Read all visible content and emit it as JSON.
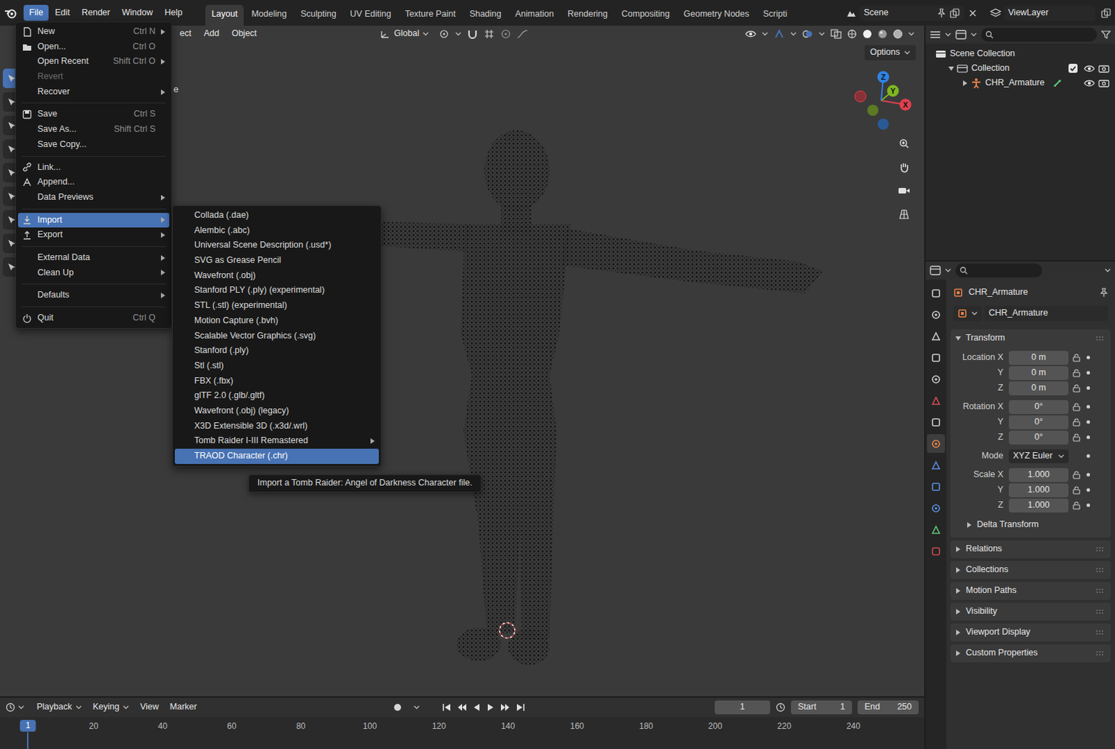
{
  "topbar": {
    "menus": [
      {
        "label": "File",
        "selected": true
      },
      {
        "label": "Edit",
        "selected": false
      },
      {
        "label": "Render",
        "selected": false
      },
      {
        "label": "Window",
        "selected": false
      },
      {
        "label": "Help",
        "selected": false
      }
    ],
    "workspaces": [
      {
        "label": "Layout",
        "selected": true
      },
      {
        "label": "Modeling",
        "selected": false
      },
      {
        "label": "Sculpting",
        "selected": false
      },
      {
        "label": "UV Editing",
        "selected": false
      },
      {
        "label": "Texture Paint",
        "selected": false
      },
      {
        "label": "Shading",
        "selected": false
      },
      {
        "label": "Animation",
        "selected": false
      },
      {
        "label": "Rendering",
        "selected": false
      },
      {
        "label": "Compositing",
        "selected": false
      },
      {
        "label": "Geometry Nodes",
        "selected": false
      },
      {
        "label": "Scripti",
        "selected": false
      }
    ],
    "scene": "Scene",
    "view_layer": "ViewLayer"
  },
  "viewport": {
    "corner_text": "e",
    "header": [
      "ect",
      "Add",
      "Object"
    ],
    "orientation": "Global",
    "options": "Options",
    "gizmo": [
      "X",
      "Y",
      "Z"
    ]
  },
  "file_menu": {
    "sections": [
      [
        {
          "label": "New",
          "shortcut": "Ctrl N",
          "submenu": true,
          "disabled": false,
          "selected": false
        },
        {
          "label": "Open...",
          "shortcut": "Ctrl O",
          "submenu": false,
          "disabled": false,
          "selected": false
        },
        {
          "label": "Open Recent",
          "shortcut": "Shift Ctrl O",
          "submenu": true,
          "disabled": false,
          "selected": false
        },
        {
          "label": "Revert",
          "submenu": false,
          "disabled": true,
          "selected": false
        },
        {
          "label": "Recover",
          "submenu": true,
          "disabled": false,
          "selected": false
        }
      ],
      [
        {
          "label": "Save",
          "shortcut": "Ctrl S",
          "submenu": false,
          "disabled": false,
          "selected": false
        },
        {
          "label": "Save As...",
          "shortcut": "Shift Ctrl S",
          "submenu": false,
          "disabled": false,
          "selected": false
        },
        {
          "label": "Save Copy...",
          "submenu": false,
          "disabled": false,
          "selected": false
        }
      ],
      [
        {
          "label": "Link...",
          "submenu": false,
          "disabled": false,
          "selected": false
        },
        {
          "label": "Append...",
          "submenu": false,
          "disabled": false,
          "selected": false
        },
        {
          "label": "Data Previews",
          "submenu": true,
          "disabled": false,
          "selected": false
        }
      ],
      [
        {
          "label": "Import",
          "submenu": true,
          "disabled": false,
          "selected": true
        },
        {
          "label": "Export",
          "submenu": true,
          "disabled": false,
          "selected": false
        }
      ],
      [
        {
          "label": "External Data",
          "submenu": true,
          "disabled": false,
          "selected": false
        },
        {
          "label": "Clean Up",
          "submenu": true,
          "disabled": false,
          "selected": false
        }
      ],
      [
        {
          "label": "Defaults",
          "submenu": true,
          "disabled": false,
          "selected": false
        }
      ],
      [
        {
          "label": "Quit",
          "shortcut": "Ctrl Q",
          "submenu": false,
          "disabled": false,
          "selected": false
        }
      ]
    ]
  },
  "import_menu": {
    "items": [
      {
        "label": "Collada (.dae)",
        "submenu": false,
        "selected": false
      },
      {
        "label": "Alembic (.abc)",
        "submenu": false,
        "selected": false
      },
      {
        "label": "Universal Scene Description (.usd*)",
        "submenu": false,
        "selected": false
      },
      {
        "label": "SVG as Grease Pencil",
        "submenu": false,
        "selected": false
      },
      {
        "label": "Wavefront (.obj)",
        "submenu": false,
        "selected": false
      },
      {
        "label": "Stanford PLY (.ply) (experimental)",
        "submenu": false,
        "selected": false
      },
      {
        "label": "STL (.stl) (experimental)",
        "submenu": false,
        "selected": false
      },
      {
        "label": "Motion Capture (.bvh)",
        "submenu": false,
        "selected": false
      },
      {
        "label": "Scalable Vector Graphics (.svg)",
        "submenu": false,
        "selected": false
      },
      {
        "label": "Stanford (.ply)",
        "submenu": false,
        "selected": false
      },
      {
        "label": "Stl (.stl)",
        "submenu": false,
        "selected": false
      },
      {
        "label": "FBX (.fbx)",
        "submenu": false,
        "selected": false
      },
      {
        "label": "glTF 2.0 (.glb/.gltf)",
        "submenu": false,
        "selected": false
      },
      {
        "label": "Wavefront (.obj) (legacy)",
        "submenu": false,
        "selected": false
      },
      {
        "label": "X3D Extensible 3D (.x3d/.wrl)",
        "submenu": false,
        "selected": false
      },
      {
        "label": "Tomb Raider I-III Remastered",
        "submenu": true,
        "selected": false
      },
      {
        "label": "TRAOD Character (.chr)",
        "submenu": false,
        "selected": true
      }
    ]
  },
  "tooltip": "Import a Tomb Raider: Angel of Darkness Character file.",
  "outliner": {
    "rows": [
      {
        "label": "Scene Collection",
        "level": 0,
        "kind": "root"
      },
      {
        "label": "Collection",
        "level": 1,
        "kind": "collection",
        "expanded": true,
        "checked": true,
        "visible": true,
        "renderable": true
      },
      {
        "label": "CHR_Armature",
        "level": 2,
        "kind": "object",
        "expanded": false,
        "visible": true,
        "renderable": true
      }
    ]
  },
  "properties": {
    "tabs": [
      {
        "selected": false
      },
      {
        "selected": false
      },
      {
        "selected": false
      },
      {
        "selected": false
      },
      {
        "selected": false
      },
      {
        "selected": false
      },
      {
        "selected": false
      },
      {
        "selected": true
      },
      {
        "selected": false
      },
      {
        "selected": false
      },
      {
        "selected": false
      },
      {
        "selected": false
      },
      {
        "selected": false
      }
    ],
    "object": "CHR_Armature",
    "datablock": "CHR_Armature",
    "transform": {
      "title": "Transform",
      "expanded": true,
      "groups": [
        [
          {
            "label": "Location X",
            "value": "0 m",
            "kind": "number"
          },
          {
            "label": "Y",
            "value": "0 m",
            "kind": "number"
          },
          {
            "label": "Z",
            "value": "0 m",
            "kind": "number"
          }
        ],
        [
          {
            "label": "Rotation X",
            "value": "0°",
            "kind": "number"
          },
          {
            "label": "Y",
            "value": "0°",
            "kind": "number"
          },
          {
            "label": "Z",
            "value": "0°",
            "kind": "number"
          }
        ],
        [
          {
            "label": "Mode",
            "value": "XYZ Euler",
            "kind": "dropdown"
          }
        ],
        [
          {
            "label": "Scale X",
            "value": "1.000",
            "kind": "number"
          },
          {
            "label": "Y",
            "value": "1.000",
            "kind": "number"
          },
          {
            "label": "Z",
            "value": "1.000",
            "kind": "number"
          }
        ]
      ],
      "subpanels": [
        {
          "title": "Delta Transform",
          "expanded": false
        }
      ]
    },
    "panels": [
      {
        "title": "Relations",
        "expanded": false
      },
      {
        "title": "Collections",
        "expanded": false
      },
      {
        "title": "Motion Paths",
        "expanded": false
      },
      {
        "title": "Visibility",
        "expanded": false
      },
      {
        "title": "Viewport Display",
        "expanded": false
      },
      {
        "title": "Custom Properties",
        "expanded": false
      }
    ]
  },
  "timeline": {
    "menus": [
      "Playback",
      "Keying",
      "View",
      "Marker"
    ],
    "frame": "1",
    "start_label": "Start",
    "start": "1",
    "end_label": "End",
    "end": "250",
    "current": "1",
    "ticks": [
      "20",
      "40",
      "60",
      "80",
      "100",
      "120",
      "140",
      "160",
      "180",
      "200",
      "220",
      "240"
    ]
  }
}
